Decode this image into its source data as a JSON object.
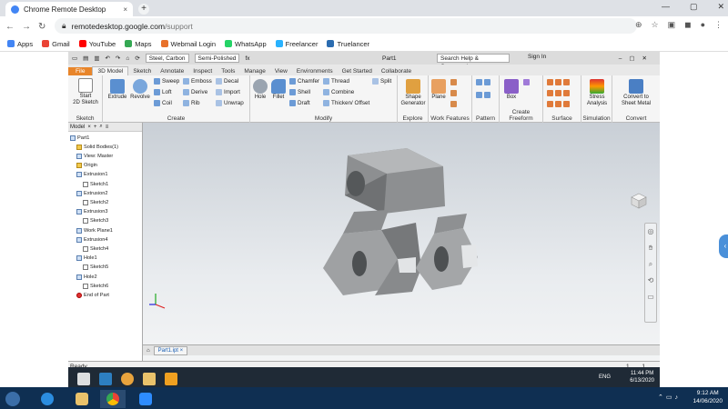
{
  "browser": {
    "tab_title": "Chrome Remote Desktop",
    "tab_close": "×",
    "new_tab": "+",
    "url_host": "remotedesktop.google.com",
    "url_path": "/support",
    "bookmarks": [
      {
        "label": "Apps",
        "color": "#4285f4"
      },
      {
        "label": "Gmail",
        "color": "#ea4335"
      },
      {
        "label": "YouTube",
        "color": "#ff0000"
      },
      {
        "label": "Maps",
        "color": "#34a853"
      },
      {
        "label": "Webmail Login",
        "color": "#e8712a"
      },
      {
        "label": "WhatsApp",
        "color": "#25d366"
      },
      {
        "label": "Freelancer",
        "color": "#29b2fe"
      },
      {
        "label": "Truelancer",
        "color": "#2b6cb0"
      }
    ]
  },
  "inventor": {
    "qat": {
      "material": "Steel, Carbon",
      "appearance": "Semi-Polished",
      "doc_name": "Part1",
      "search_placeholder": "Search Help & Commands...",
      "sign_in": "Sign In"
    },
    "ribbon_tabs": [
      "File",
      "3D Model",
      "Sketch",
      "Annotate",
      "Inspect",
      "Tools",
      "Manage",
      "View",
      "Environments",
      "Get Started",
      "Collaborate"
    ],
    "active_tab": "3D Model",
    "groups": {
      "sketch": {
        "label": "Sketch",
        "start_line1": "Start",
        "start_line2": "2D Sketch"
      },
      "create": {
        "label": "Create",
        "extrude": "Extrude",
        "revolve": "Revolve",
        "sweep": "Sweep",
        "loft": "Loft",
        "coil": "Coil",
        "emboss": "Emboss",
        "derive": "Derive",
        "rib": "Rib",
        "decal": "Decal",
        "import": "Import",
        "unwrap": "Unwrap"
      },
      "modify": {
        "label": "Modify",
        "hole": "Hole",
        "fillet": "Fillet",
        "chamfer": "Chamfer",
        "shell": "Shell",
        "draft": "Draft",
        "thread": "Thread",
        "combine": "Combine",
        "thicken": "Thicken/ Offset",
        "split": "Split"
      },
      "explore": {
        "label": "Explore",
        "shape_line1": "Shape",
        "shape_line2": "Generator"
      },
      "work": {
        "label": "Work Features",
        "plane": "Plane"
      },
      "pattern": {
        "label": "Pattern"
      },
      "freeform": {
        "label": "Create Freeform",
        "box": "Box"
      },
      "surface": {
        "label": "Surface"
      },
      "simulation": {
        "label": "Simulation",
        "stress_line1": "Stress",
        "stress_line2": "Analysis"
      },
      "convert": {
        "label": "Convert",
        "line1": "Convert to",
        "line2": "Sheet Metal"
      }
    },
    "browser_panel": {
      "title": "Model",
      "nodes": [
        "Part1",
        "Solid Bodies(1)",
        "View: Master",
        "Origin",
        "Extrusion1",
        "Sketch1",
        "Extrusion2",
        "Sketch2",
        "Extrusion3",
        "Sketch3",
        "Work Plane1",
        "Extrusion4",
        "Sketch4",
        "Hole1",
        "Sketch5",
        "Hole2",
        "Sketch6",
        "End of Part"
      ]
    },
    "doc_tab": "Part1.ipt",
    "doc_tab_close": "×",
    "status": "Ready",
    "status_nums": "1  1"
  },
  "remote_taskbar": {
    "lang": "ENG",
    "time": "11:44 PM",
    "date": "6/13/2020"
  },
  "local_taskbar": {
    "time": "9:12 AM",
    "date": "14/06/2020"
  }
}
